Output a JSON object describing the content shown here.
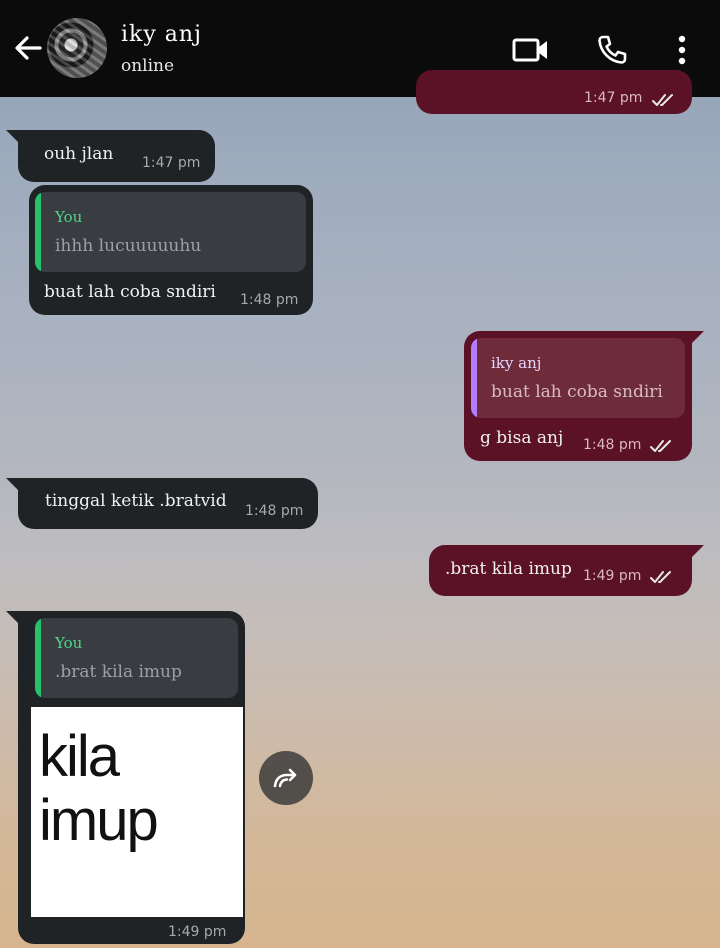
{
  "header": {
    "contact_name": "iky anj",
    "status": "online",
    "icons": [
      "back-arrow-icon",
      "video-call-icon",
      "phone-icon",
      "more-vertical-icon"
    ]
  },
  "colors": {
    "incoming_bubble": "#1f2325",
    "outgoing_bubble": "#5b1126",
    "quote_green": "#25c26b",
    "quote_purple": "#b47cff",
    "header_bg": "#0b0b0b"
  },
  "messages": [
    {
      "direction": "out",
      "text": "",
      "time": "1:47 pm",
      "ticks": "read"
    },
    {
      "direction": "in",
      "text": "ouh jlan",
      "time": "1:47 pm"
    },
    {
      "direction": "in",
      "reply_to": {
        "author": "You",
        "text": "ihhh lucuuuuuhu"
      },
      "text": "buat lah coba sndiri",
      "time": "1:48 pm"
    },
    {
      "direction": "out",
      "reply_to": {
        "author": "iky anj",
        "text": "buat lah coba sndiri"
      },
      "text": "g bisa anj",
      "time": "1:48 pm",
      "ticks": "read"
    },
    {
      "direction": "in",
      "text": "tinggal ketik .bratvid",
      "time": "1:48 pm"
    },
    {
      "direction": "out",
      "text": ".brat kila imup",
      "time": "1:49 pm",
      "ticks": "read"
    },
    {
      "direction": "in",
      "reply_to": {
        "author": "You",
        "text": ".brat kila imup"
      },
      "sticker_text": [
        "kila",
        "imup"
      ],
      "time": "1:49 pm"
    }
  ]
}
